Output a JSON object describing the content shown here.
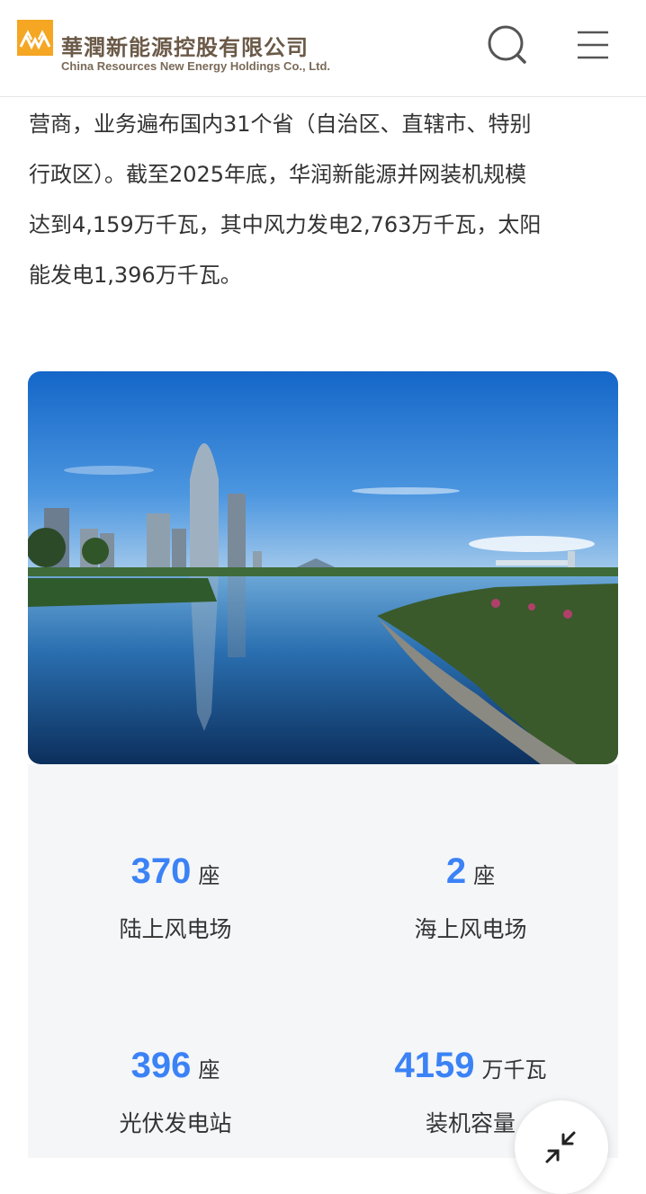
{
  "header": {
    "company_name_cn": "華潤新能源控股有限公司",
    "company_name_en": "China Resources New Energy Holdings Co., Ltd.",
    "brand_color": "#f5a623",
    "search_icon": "search-icon",
    "menu_icon": "hamburger-menu-icon"
  },
  "intro": {
    "line1": "营商，业务遍布国内31个省（自治区、直辖市、特别",
    "line2": "行政区）。截至2025年底，华润新能源并网装机规模",
    "line3": "达到4,159万千瓦，其中风力发电2,763万千瓦，太阳",
    "line4": "能发电1,396万千瓦。"
  },
  "stats": [
    {
      "value": "370",
      "unit": "座",
      "label": "陆上风电场"
    },
    {
      "value": "2",
      "unit": "座",
      "label": "海上风电场"
    },
    {
      "value": "396",
      "unit": "座",
      "label": "光伏发电站"
    },
    {
      "value": "4159",
      "unit": "万千瓦",
      "label": "装机容量"
    }
  ],
  "colors": {
    "accent_blue": "#3b82f6",
    "panel_bg": "#f4f6f8"
  },
  "fab": {
    "icon": "collapse-arrows-icon"
  }
}
